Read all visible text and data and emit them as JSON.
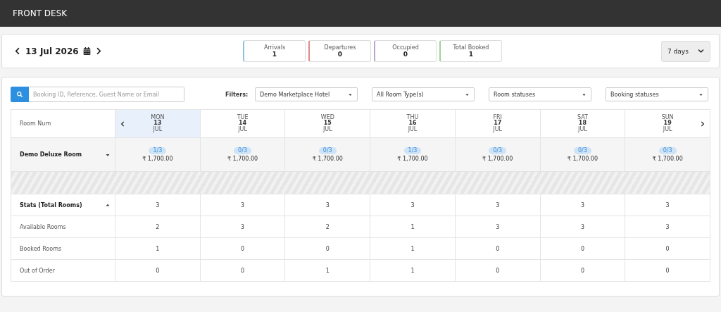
{
  "header": {
    "title": "FRONT DESK"
  },
  "date_nav": {
    "date": "13 Jul 2026"
  },
  "summary": [
    {
      "label": "Arrivals",
      "value": "1",
      "color": "#8fc1e3"
    },
    {
      "label": "Departures",
      "value": "0",
      "color": "#e08a8a"
    },
    {
      "label": "Occupied",
      "value": "0",
      "color": "#b9a3d1"
    },
    {
      "label": "Total Booked",
      "value": "1",
      "color": "#9fd39a"
    }
  ],
  "range_select": {
    "value": "7 days"
  },
  "search": {
    "placeholder": "Booking ID, Reference, Guest Name or Email"
  },
  "filters": {
    "label": "Filters:",
    "selects": [
      "Demo Marketplace Hotel",
      "All Room Type(s)",
      "Room statuses",
      "Booking statuses"
    ]
  },
  "table": {
    "corner": "Room Num",
    "days": [
      {
        "weekday": "MON",
        "day": "13",
        "month": "JUL",
        "selected": true
      },
      {
        "weekday": "TUE",
        "day": "14",
        "month": "JUL",
        "selected": false
      },
      {
        "weekday": "WED",
        "day": "15",
        "month": "JUL",
        "selected": false
      },
      {
        "weekday": "THU",
        "day": "16",
        "month": "JUL",
        "selected": false
      },
      {
        "weekday": "FRI",
        "day": "17",
        "month": "JUL",
        "selected": false
      },
      {
        "weekday": "SAT",
        "day": "18",
        "month": "JUL",
        "selected": false
      },
      {
        "weekday": "SUN",
        "day": "19",
        "month": "JUL",
        "selected": false
      }
    ],
    "room_types": [
      {
        "name": "Demo Deluxe Room",
        "expanded": false,
        "cells": [
          {
            "occupancy": "1/3",
            "price": "₹ 1,700.00"
          },
          {
            "occupancy": "0/3",
            "price": "₹ 1,700.00"
          },
          {
            "occupancy": "0/3",
            "price": "₹ 1,700.00"
          },
          {
            "occupancy": "1/3",
            "price": "₹ 1,700.00"
          },
          {
            "occupancy": "0/3",
            "price": "₹ 1,700.00"
          },
          {
            "occupancy": "0/3",
            "price": "₹ 1,700.00"
          },
          {
            "occupancy": "0/3",
            "price": "₹ 1,700.00"
          }
        ]
      }
    ],
    "stats": {
      "title": "Stats (Total Rooms)",
      "expanded": true,
      "totals": [
        "3",
        "3",
        "3",
        "3",
        "3",
        "3",
        "3"
      ],
      "rows": [
        {
          "label": "Available Rooms",
          "values": [
            "2",
            "3",
            "2",
            "1",
            "3",
            "3",
            "3"
          ]
        },
        {
          "label": "Booked Rooms",
          "values": [
            "1",
            "0",
            "0",
            "1",
            "0",
            "0",
            "0"
          ]
        },
        {
          "label": "Out of Order",
          "values": [
            "0",
            "0",
            "1",
            "1",
            "0",
            "0",
            "0"
          ]
        }
      ]
    }
  }
}
